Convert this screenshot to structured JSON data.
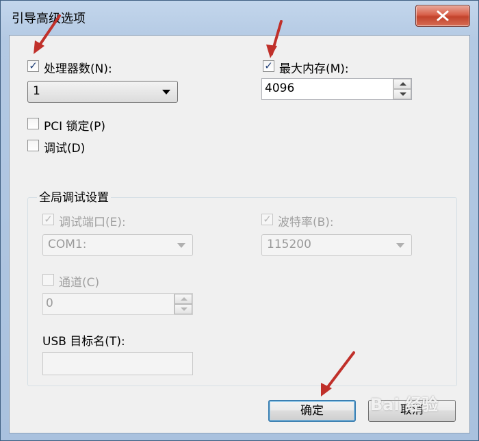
{
  "window": {
    "title": "引导高级选项"
  },
  "processors": {
    "label": "处理器数(N):",
    "checked": true,
    "value": "1"
  },
  "max_memory": {
    "label": "最大内存(M):",
    "checked": true,
    "value": "4096"
  },
  "pci_lock": {
    "label": "PCI 锁定(P)",
    "checked": false
  },
  "debug": {
    "label": "调试(D)",
    "checked": false
  },
  "global_debug": {
    "title": "全局调试设置",
    "debug_port": {
      "label": "调试端口(E):",
      "checked": true,
      "enabled": false,
      "value": "COM1:"
    },
    "baud_rate": {
      "label": "波特率(B):",
      "checked": true,
      "enabled": false,
      "value": "115200"
    },
    "channel": {
      "label": "通道(C)",
      "checked": false,
      "enabled": false,
      "value": "0"
    },
    "usb_target": {
      "label": "USB 目标名(T):",
      "value": ""
    }
  },
  "buttons": {
    "ok": "确定",
    "cancel": "取消"
  },
  "watermark": "Bai 经验",
  "colors": {
    "annotation_arrow": "#c0302a",
    "accent": "#3c7fb1"
  },
  "icons": {
    "close": "close-icon",
    "check": "checkmark-icon",
    "dropdown": "chevron-down-icon"
  }
}
